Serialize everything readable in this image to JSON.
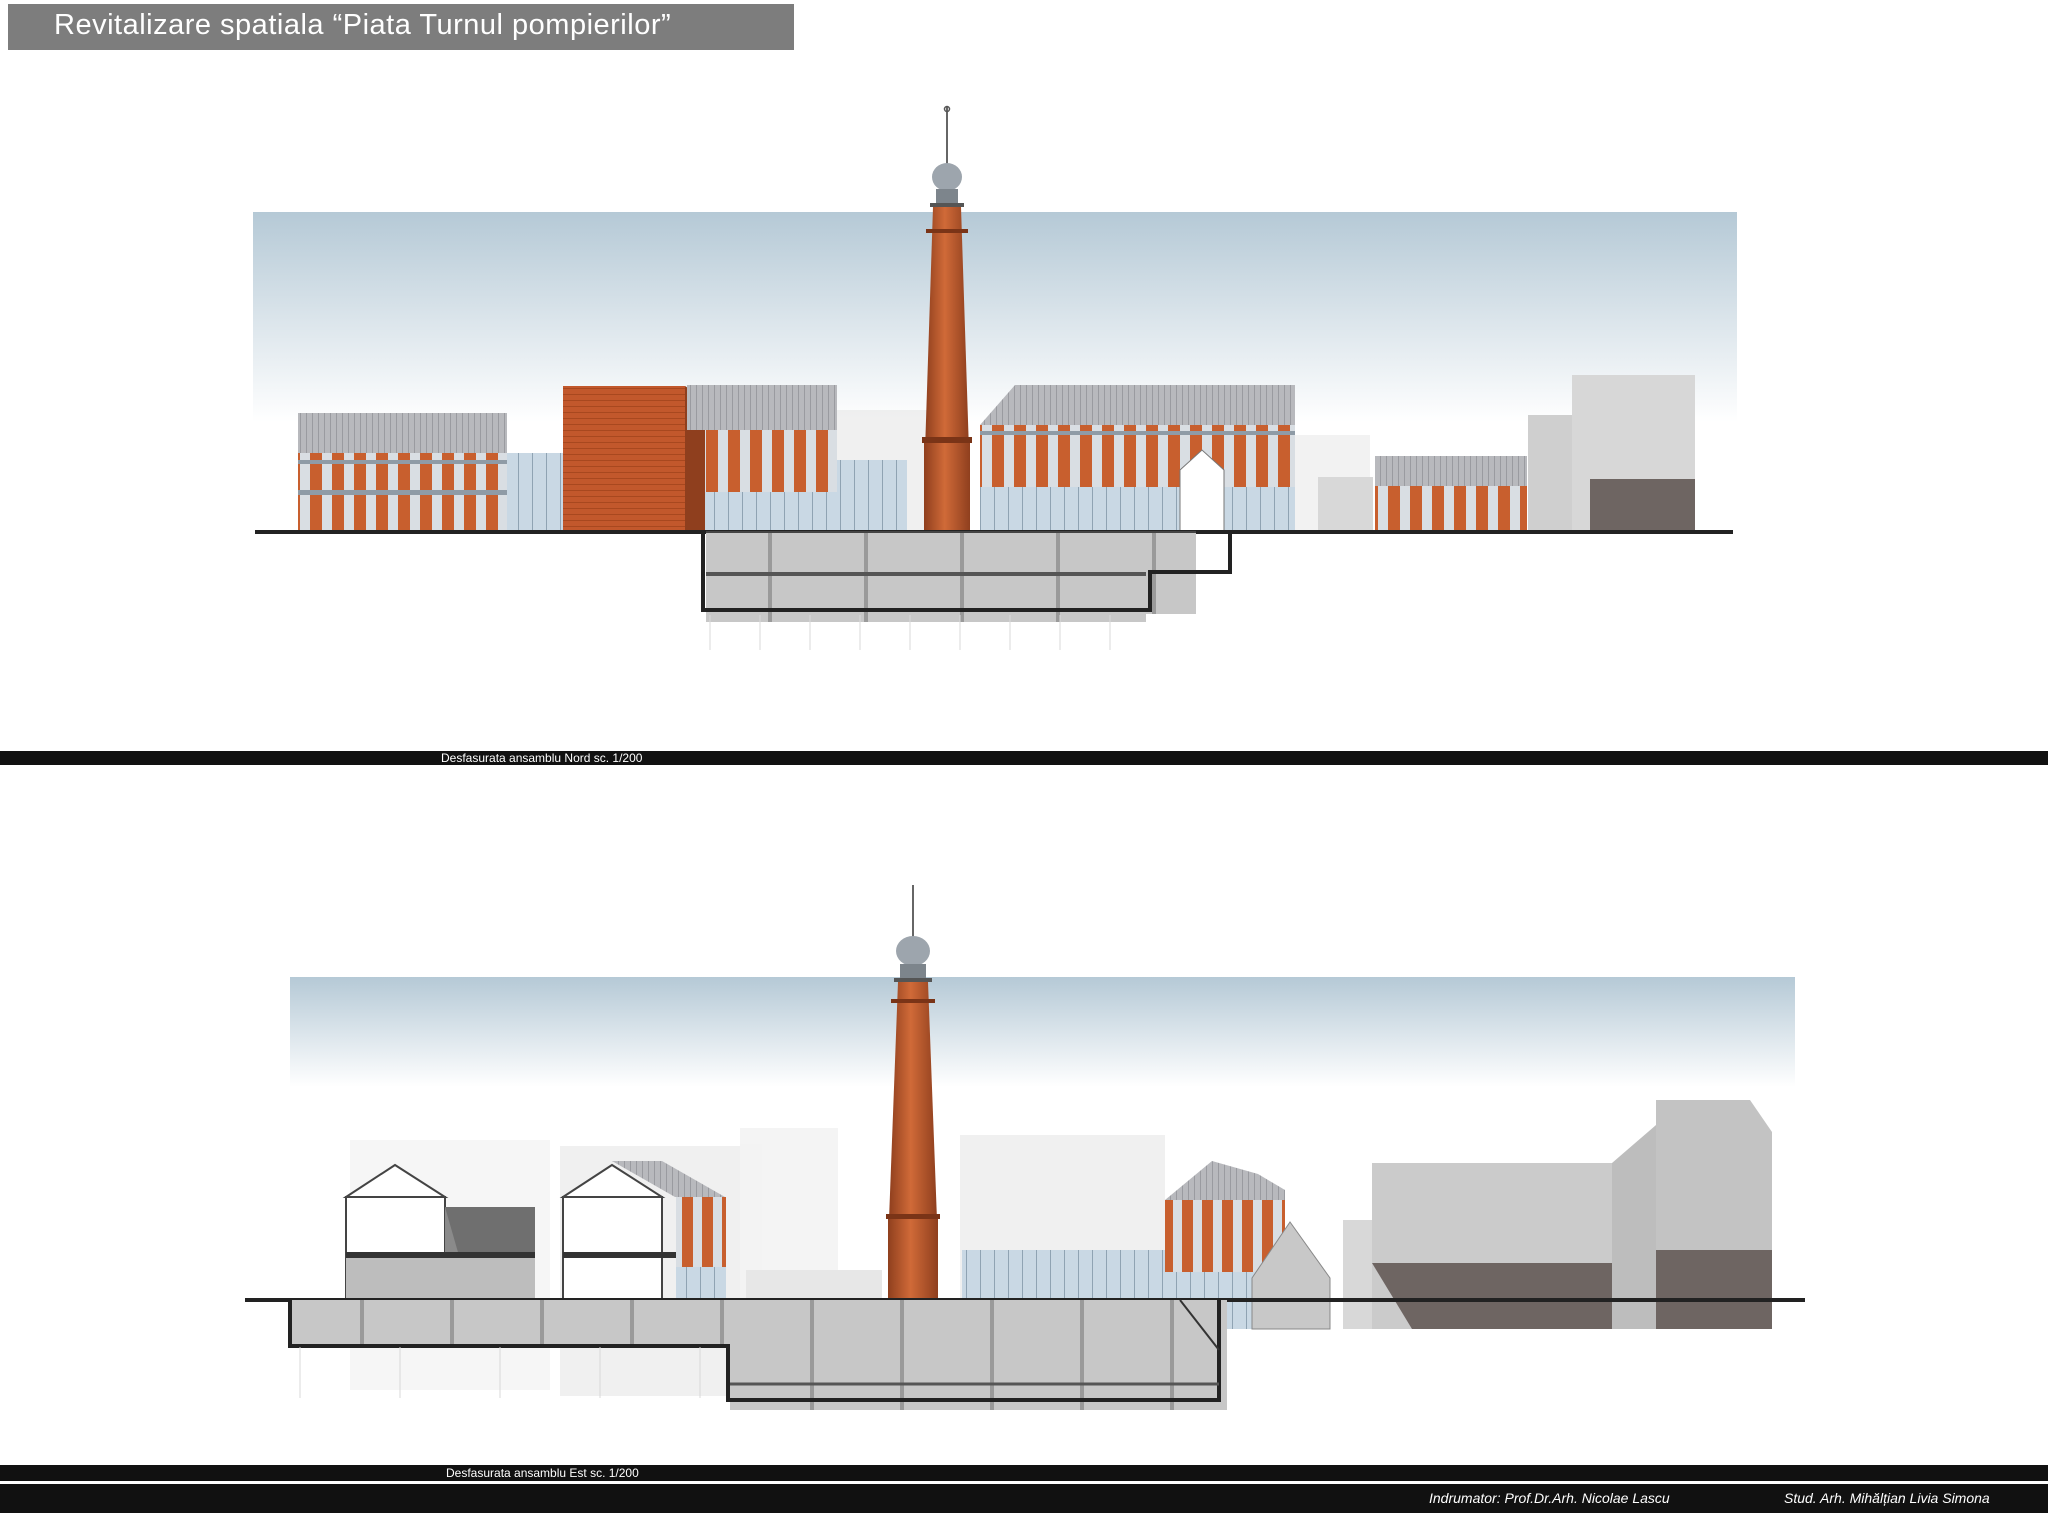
{
  "sheet": {
    "title": "Revitalizare spatiala “Piata Turnul pompierilor”"
  },
  "elevation_north": {
    "caption": "Desfasurata ansamblu Nord  sc. 1/200"
  },
  "elevation_east": {
    "caption": "Desfasurata ansamblu Est  sc. 1/200"
  },
  "footer": {
    "tutor": "Indrumator: Prof.Dr.Arh. Nicolae Lascu",
    "student": "Stud. Arh. Mihălțian Livia Simona"
  },
  "colors": {
    "title_bar": "#7d7d7d",
    "brick": "#c2582c",
    "tower": "#b9552b",
    "roof_gray": "#b4b4b8",
    "sky_top": "#b5c9d6",
    "dark_bar": "#111111",
    "concrete": "#d5d5d5",
    "shadow_gray": "#6e6562"
  }
}
